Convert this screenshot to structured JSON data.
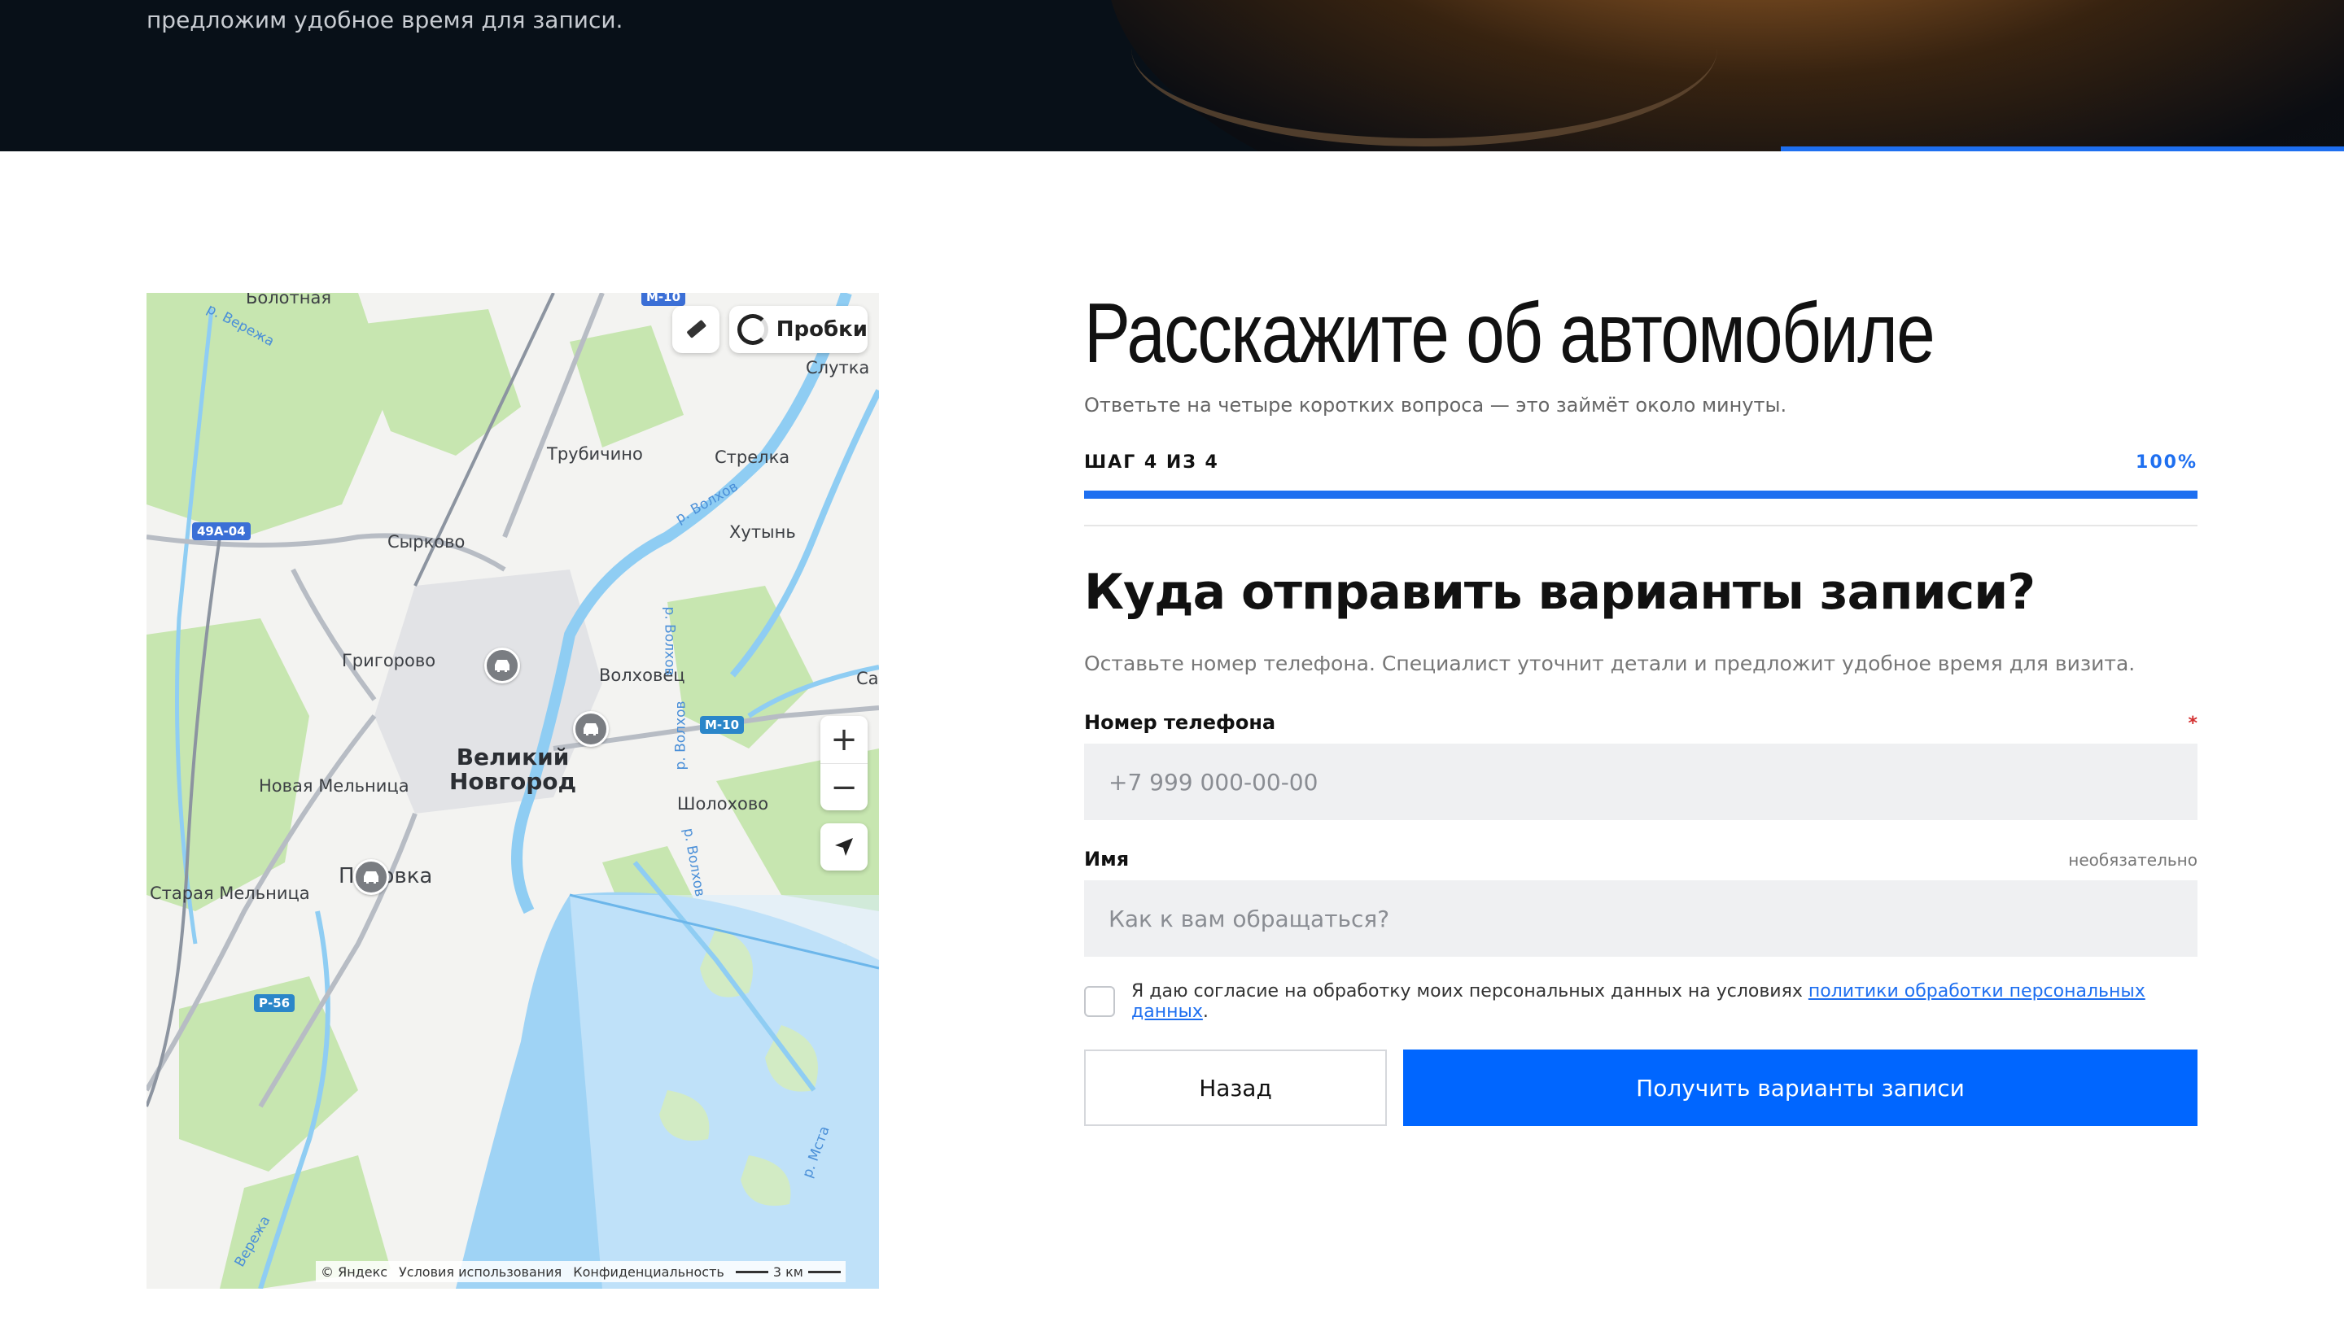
{
  "hero": {
    "text": "предложим удобное время для записи."
  },
  "map": {
    "traffic_label": "Пробки",
    "labels": {
      "bolotnaya": "Болотная",
      "slutka": "Слутка",
      "trubichino": "Трубичино",
      "strelka": "Стрелка",
      "syrkovo": "Сырково",
      "khutyn": "Хутынь",
      "grigorovo": "Григорово",
      "volkhovets": "Волховец",
      "sa": "Са",
      "novaya_melnitsa": "Новая Мельница",
      "shcholokhovo": "Шолохово",
      "pankovka": "Пановка",
      "staraya_melnitsa": "Старая Мельница",
      "city": "Великий\nНовгород"
    },
    "river_labels": {
      "veryazha_top": "р. Вережа",
      "volkhov_ne": "р. Волхов",
      "volkhov_1": "р. Волхов",
      "volkhov_2": "р. Волхов",
      "volkhov_3": "р. Волхов",
      "msta": "р. Мста",
      "veryazha_bottom": "Вережа"
    },
    "routes": {
      "r49a": "49А-04",
      "m10_top": "М-10",
      "m10": "М-10",
      "p56": "Р-56"
    },
    "zoom_in": "+",
    "zoom_out": "−",
    "footer": {
      "copyright": "© Яндекс",
      "terms": "Условия использования",
      "privacy": "Конфиденциальность",
      "scale": "3 км"
    }
  },
  "form": {
    "title": "Расскажите об автомобиле",
    "subtitle": "Ответьте на четыре коротких вопроса — это займёт около минуты.",
    "step_label": "ШАГ 4 ИЗ 4",
    "step_percent": "100%",
    "progress": 1.0,
    "question": "Куда отправить варианты записи?",
    "question_desc": "Оставьте номер телефона. Специалист уточнит детали и предложит удобное время для визита.",
    "phone": {
      "label": "Номер телефона",
      "required_mark": "*",
      "placeholder": "+7 999 000-00-00",
      "value": ""
    },
    "name": {
      "label": "Имя",
      "optional": "необязательно",
      "placeholder": "Как к вам обращаться?",
      "value": ""
    },
    "consent": {
      "text": "Я даю согласие на обработку моих персональных данных на условиях ",
      "link": "политики обработки персональных данных",
      "tail": ".",
      "checked": false
    },
    "back_label": "Назад",
    "submit_label": "Получить варианты записи"
  },
  "colors": {
    "accent": "#0066ff",
    "progress": "#1e6ff0",
    "required": "#d32f2f"
  }
}
